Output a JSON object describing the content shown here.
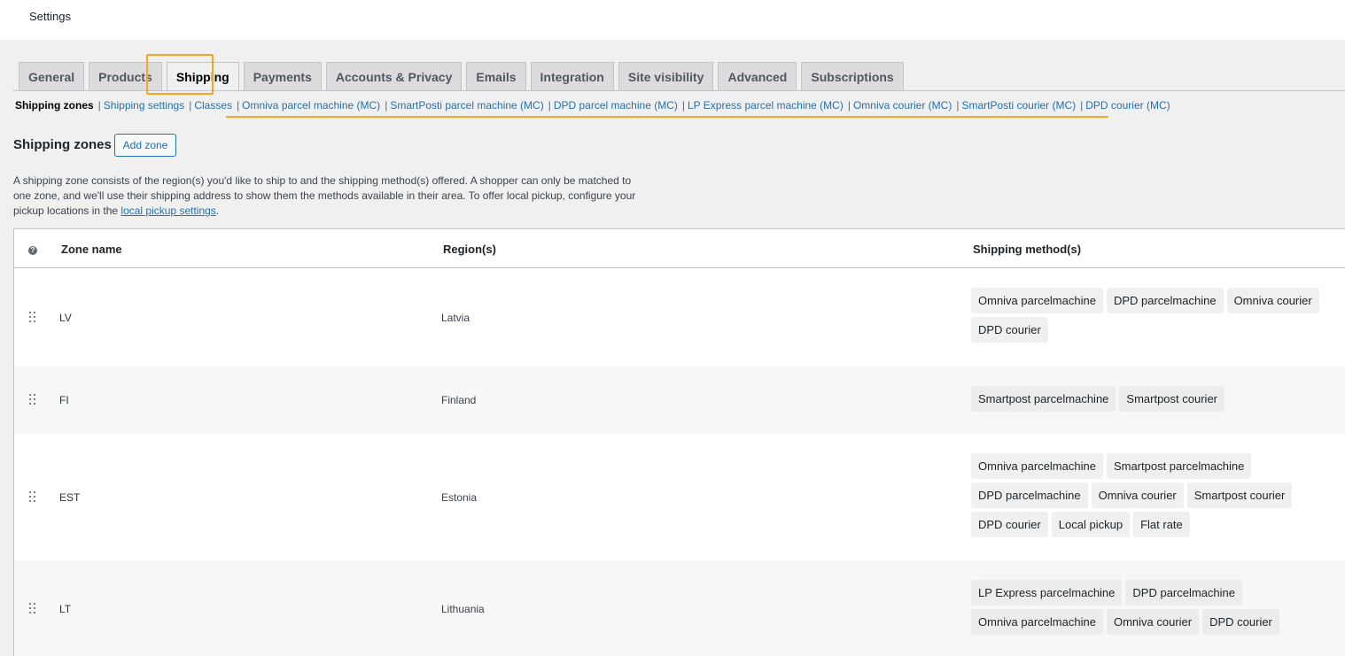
{
  "header": {
    "title": "Settings"
  },
  "tabs": [
    {
      "label": "General"
    },
    {
      "label": "Products"
    },
    {
      "label": "Shipping",
      "active": true
    },
    {
      "label": "Payments"
    },
    {
      "label": "Accounts & Privacy"
    },
    {
      "label": "Emails"
    },
    {
      "label": "Integration"
    },
    {
      "label": "Site visibility"
    },
    {
      "label": "Advanced"
    },
    {
      "label": "Subscriptions"
    }
  ],
  "sections": {
    "current": "Shipping zones",
    "links": [
      "Shipping settings",
      "Classes",
      "Omniva parcel machine (MC)",
      "SmartPosti parcel machine (MC)",
      "DPD parcel machine (MC)",
      "LP Express parcel machine (MC)",
      "Omniva courier (MC)",
      "SmartPosti courier (MC)",
      "DPD courier (MC)"
    ]
  },
  "page": {
    "heading": "Shipping zones",
    "add_zone_label": "Add zone",
    "description_text": "A shipping zone consists of the region(s) you'd like to ship to and the shipping method(s) offered. A shopper can only be matched to one zone, and we'll use their shipping address to show them the methods available in their area. To offer local pickup, configure your pickup locations in the ",
    "description_link": "local pickup settings",
    "description_end": "."
  },
  "table": {
    "help_icon": "?",
    "columns": {
      "zone": "Zone name",
      "region": "Region(s)",
      "methods": "Shipping method(s)"
    },
    "rows": [
      {
        "zone": "LV",
        "region": "Latvia",
        "methods": [
          "Omniva parcelmachine",
          "DPD parcelmachine",
          "Omniva courier",
          "DPD courier"
        ]
      },
      {
        "zone": "FI",
        "region": "Finland",
        "methods": [
          "Smartpost parcelmachine",
          "Smartpost courier"
        ]
      },
      {
        "zone": "EST",
        "region": "Estonia",
        "methods": [
          "Omniva parcelmachine",
          "Smartpost parcelmachine",
          "DPD parcelmachine",
          "Omniva courier",
          "Smartpost courier",
          "DPD courier",
          "Local pickup",
          "Flat rate"
        ]
      },
      {
        "zone": "LT",
        "region": "Lithuania",
        "methods": [
          "LP Express parcelmachine",
          "DPD parcelmachine",
          "Omniva parcelmachine",
          "Omniva courier",
          "DPD courier"
        ]
      }
    ]
  },
  "colors": {
    "accent": "#2271b1",
    "highlight": "#f5a623"
  }
}
